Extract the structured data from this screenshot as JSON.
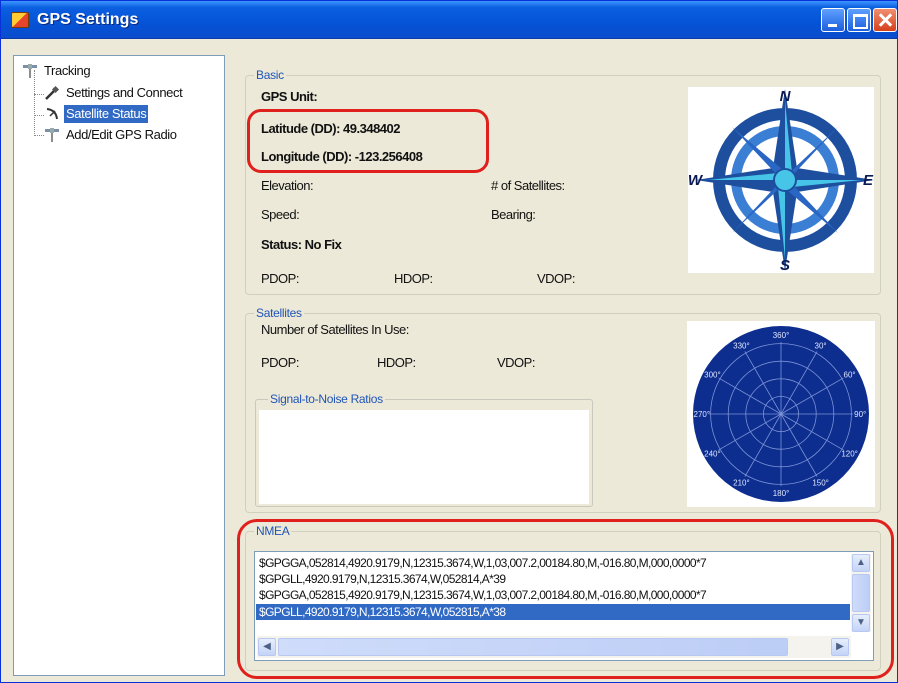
{
  "window": {
    "title": "GPS Settings",
    "accent": "#0a5fe0",
    "selection": "#316ac5"
  },
  "title_buttons": {
    "minimize_icon": "minimize-icon",
    "maximize_icon": "maximize-icon",
    "close_icon": "close-icon"
  },
  "tree": {
    "root": {
      "label": "Tracking",
      "icon": "satellite-icon"
    },
    "children": [
      {
        "label": "Settings and Connect",
        "icon": "plug-icon",
        "selected": false
      },
      {
        "label": "Satellite Status",
        "icon": "satellite-dish-icon",
        "selected": true
      },
      {
        "label": "Add/Edit GPS Radio",
        "icon": "antenna-icon",
        "selected": false
      }
    ]
  },
  "basic": {
    "legend": "Basic",
    "gps_unit": "GPS Unit:",
    "latitude": "Latitude (DD): 49.348402",
    "longitude": "Longitude (DD): -123.256408",
    "elevation": "Elevation:",
    "num_satellites": "# of Satellites:",
    "speed": "Speed:",
    "bearing": "Bearing:",
    "status": "Status: No Fix",
    "pdop": "PDOP:",
    "hdop": "HDOP:",
    "vdop": "VDOP:"
  },
  "compass": {
    "n": "N",
    "s": "S",
    "e": "E",
    "w": "W"
  },
  "satellites": {
    "legend": "Satellites",
    "in_use": "Number of Satellites In Use:",
    "pdop": "PDOP:",
    "hdop": "HDOP:",
    "vdop": "VDOP:",
    "snr_legend": "Signal-to-Noise Ratios"
  },
  "skyplot": {
    "labels": [
      "360°",
      "30°",
      "60°",
      "90°",
      "120°",
      "150°",
      "180°",
      "210°",
      "240°",
      "270°",
      "300°",
      "330°"
    ]
  },
  "nmea": {
    "legend": "NMEA",
    "lines": [
      "$GPGGA,052814,4920.9179,N,12315.3674,W,1,03,007.2,00184.80,M,-016.80,M,000,0000*7",
      "$GPGLL,4920.9179,N,12315.3674,W,052814,A*39",
      "$GPGGA,052815,4920.9179,N,12315.3674,W,1,03,007.2,00184.80,M,-016.80,M,000,0000*7",
      "$GPGLL,4920.9179,N,12315.3674,W,052815,A*38"
    ],
    "selected_index": 3,
    "scroll_up": "▲",
    "scroll_down": "▼",
    "scroll_left": "◀",
    "scroll_right": "▶"
  }
}
